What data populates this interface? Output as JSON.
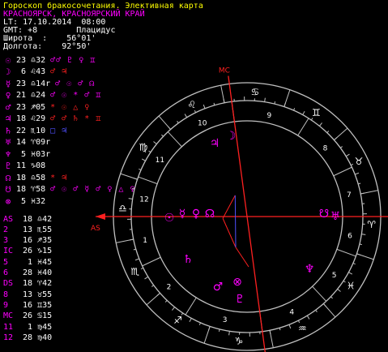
{
  "header": {
    "title": "Гороскоп бракосочетания. Элективная карта",
    "place": "КРАСНОЯРСК, КРАСНОЯРСКИЙ КРАЙ",
    "lt": "LT: 17.10.2014  08:00",
    "gmt": "GMT: +8        Плацидус",
    "lat": "Широта  :    56°01'",
    "lon": "Долгота:    92°50'"
  },
  "colors": {
    "yellow": "#ffff00",
    "white": "#ffffff",
    "magenta": "#ff00ff",
    "red": "#ff2020",
    "blue": "#5050ff",
    "wheel": "#c0c0c0"
  },
  "planets": [
    {
      "glyph": "☉",
      "pos": "23 ♎32",
      "color": "#ff00ff",
      "asp": "♂♂ ♇ ♀ ♊",
      "asp_color": "#ff00ff"
    },
    {
      "glyph": "☽",
      "pos": " 6 ♌43",
      "color": "#ff00ff",
      "asp": "♂ ♃",
      "asp_color": "#ff2020"
    },
    {
      "glyph": "☿",
      "pos": "23 ♎14r",
      "color": "#ff00ff",
      "asp": "♂ ☉ ♂ ☊",
      "asp_color": "#ff00ff"
    },
    {
      "glyph": "♀",
      "pos": "21 ♎24",
      "color": "#ff00ff",
      "asp": "♂ ☉ * ♂ ♊",
      "asp_color": "#ff00ff"
    },
    {
      "glyph": "♂",
      "pos": "23 ♐05",
      "color": "#ff00ff",
      "asp": "* ☉ △ ♀",
      "asp_color": "#ff2020"
    },
    {
      "glyph": "♃",
      "pos": "18 ♌29",
      "color": "#ff00ff",
      "asp": "♂ ♂ ♄ * ♊",
      "asp_color": "#ff2020"
    },
    {
      "glyph": "♄",
      "pos": "22 ♏10",
      "color": "#ff00ff",
      "asp": "□ ♃",
      "asp_color": "#5050ff"
    },
    {
      "glyph": "♅",
      "pos": "14 ♈09r",
      "color": "#ff00ff",
      "asp": "",
      "asp_color": "#ff00ff"
    },
    {
      "glyph": "♆",
      "pos": " 5 ♓03r",
      "color": "#ff00ff",
      "asp": "",
      "asp_color": "#ff00ff"
    },
    {
      "glyph": "♇",
      "pos": "11 ♑08",
      "color": "#ff00ff",
      "asp": "",
      "asp_color": "#ff00ff"
    },
    {
      "glyph": "☊",
      "pos": "18 ♎58",
      "color": "#ff00ff",
      "asp": "* ♃",
      "asp_color": "#ff2020"
    },
    {
      "glyph": "☋",
      "pos": "18 ♈58",
      "color": "#ff00ff",
      "asp": "♂ ☉ ♂ ☿ ♂ ♀ △ ♀",
      "asp_color": "#ff00ff"
    },
    {
      "glyph": "⊗",
      "pos": " 5 ♓32",
      "color": "#ff00ff",
      "asp": "",
      "asp_color": "#ff00ff"
    }
  ],
  "houses": [
    {
      "label": "AS",
      "pos": "18 ♎42"
    },
    {
      "label": "2",
      "pos": "13 ♏55"
    },
    {
      "label": "3",
      "pos": "16 ♐35"
    },
    {
      "label": "IC",
      "pos": "26 ♑15"
    },
    {
      "label": "5",
      "pos": " 1 ♓45"
    },
    {
      "label": "6",
      "pos": "28 ♓40"
    },
    {
      "label": "DS",
      "pos": "18 ♈42"
    },
    {
      "label": "8",
      "pos": "13 ♉55"
    },
    {
      "label": "9",
      "pos": "16 ♊35"
    },
    {
      "label": "MC",
      "pos": "26 ♋15"
    },
    {
      "label": "11",
      "pos": " 1 ♍45"
    },
    {
      "label": "12",
      "pos": "28 ♍40"
    }
  ],
  "wheel": {
    "mc_label": "MC",
    "as_label": "AS",
    "house_numbers": [
      "1",
      "2",
      "3",
      "4",
      "5",
      "6",
      "7",
      "8",
      "9",
      "10",
      "11",
      "12"
    ],
    "signs": [
      "♎",
      "♏",
      "♐",
      "♑",
      "♒",
      "♓",
      "♈",
      "♉",
      "♊",
      "♋",
      "♌",
      "♍"
    ]
  }
}
